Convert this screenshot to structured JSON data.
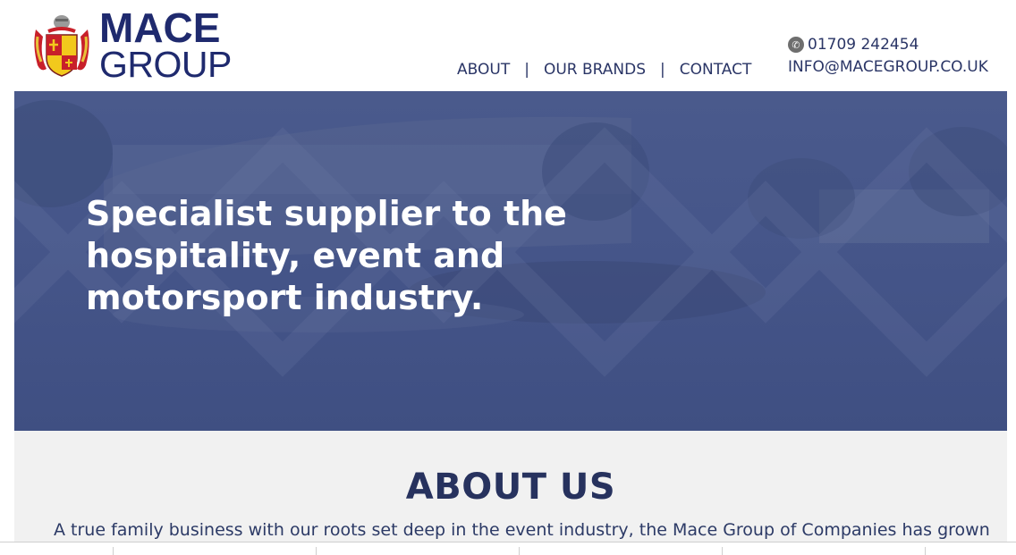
{
  "brand": {
    "name_top": "MACE",
    "name_bottom": "GROUP"
  },
  "nav": {
    "items": [
      {
        "label": "ABOUT"
      },
      {
        "label": "OUR BRANDS"
      },
      {
        "label": "CONTACT"
      }
    ],
    "separator": "|"
  },
  "contact": {
    "phone_icon": "phone-icon",
    "phone": "01709 242454",
    "email": "INFO@MACEGROUP.CO.UK"
  },
  "hero": {
    "title": "Specialist supplier to the hospitality, event and motorsport industry.",
    "overlay_color": "#45558a"
  },
  "about": {
    "heading": "ABOUT US",
    "text": "A true family business with our roots set deep in the event industry, the Mace Group of Companies has grown"
  },
  "colors": {
    "brand_navy": "#1f2a6e",
    "hero_blue": "#45558a",
    "about_bg": "#f1f1f1"
  }
}
